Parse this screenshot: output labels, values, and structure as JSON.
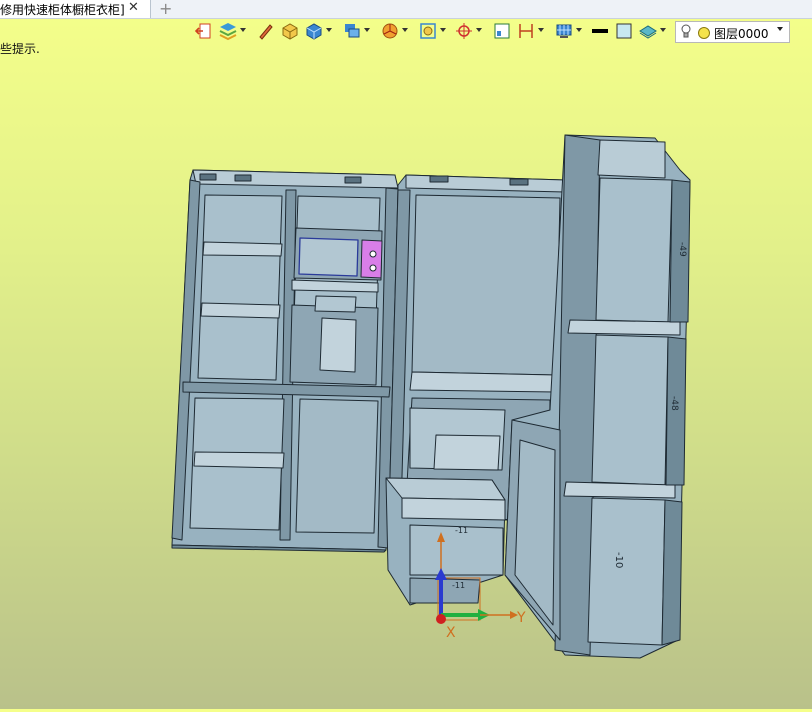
{
  "tab": {
    "title": "修用快速柜体橱柜衣柜]",
    "close": "✕",
    "add": "+"
  },
  "hint": "些提示.",
  "toolbar": {
    "icons": [
      "exit-view-icon",
      "layer-stack-icon",
      "pencil-icon",
      "solid-box-icon",
      "cube-shade-icon",
      "multi-view-icon",
      "pie-render-icon",
      "zoom-fit-icon",
      "crosshair-icon",
      "frame-icon",
      "dimension-icon",
      "grid-display-icon",
      "line-color-icon",
      "fill-color-icon",
      "material-icon"
    ]
  },
  "layer": {
    "name": "图层0000"
  },
  "model": {
    "labels": {
      "top_right": "-49",
      "mid_right": "-48",
      "bottom_right": "-10",
      "front_small_1": "-11",
      "front_small_2": "-11"
    },
    "axes": {
      "x": "X",
      "y": "Y"
    }
  },
  "colors": {
    "model_fill": "#98b2c0",
    "model_dark": "#6f8a98",
    "model_light": "#b9ccd6",
    "edge": "#1e2a33",
    "highlight": "#d87ee8"
  }
}
